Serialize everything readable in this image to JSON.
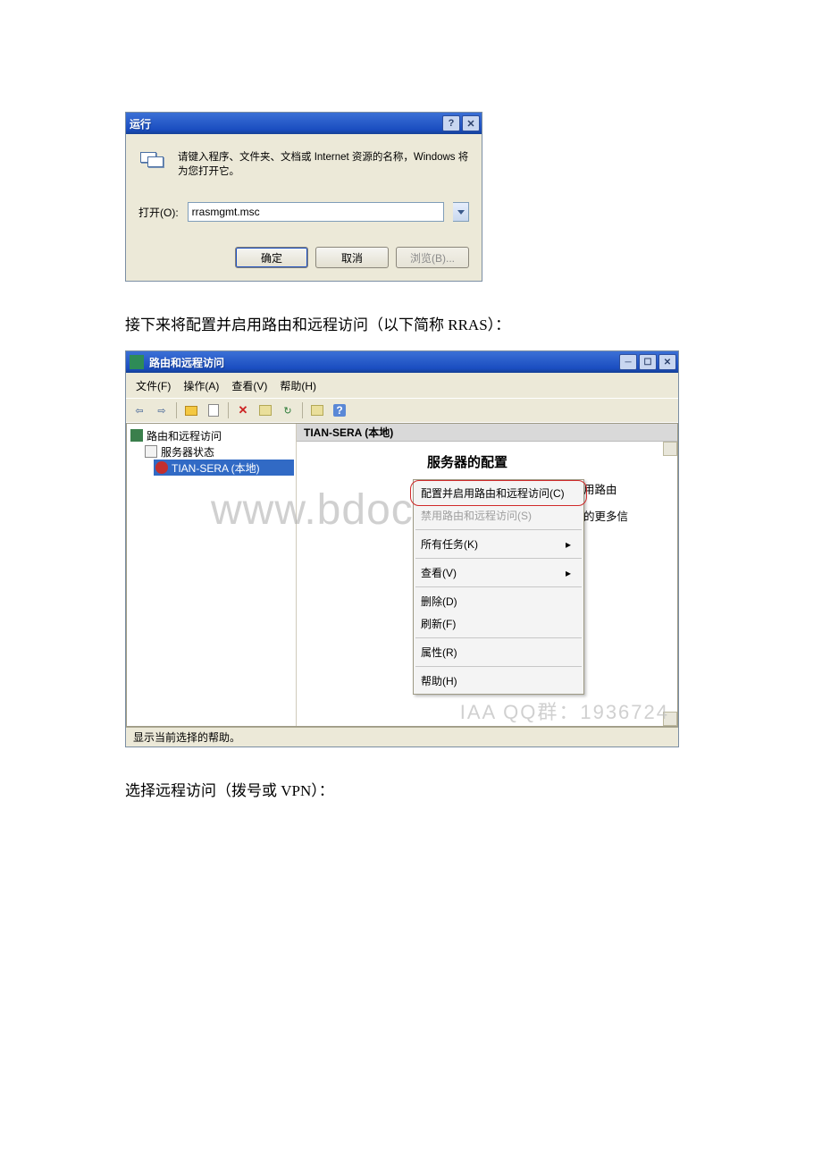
{
  "run_dialog": {
    "title": "运行",
    "description": "请键入程序、文件夹、文档或 Internet 资源的名称，Windows 将为您打开它。",
    "open_label": "打开(O):",
    "open_value": "rrasmgmt.msc",
    "ok_button": "确定",
    "cancel_button": "取消",
    "browse_button": "浏览(B)..."
  },
  "caption1": "接下来将配置并启用路由和远程访问（以下简称 RRAS）：",
  "caption2": "选择远程访问（拨号或 VPN）：",
  "mmc": {
    "title": "路由和远程访问",
    "menus": {
      "file": "文件(F)",
      "action": "操作(A)",
      "view": "查看(V)",
      "help": "帮助(H)"
    },
    "tree": {
      "root": "路由和远程访问",
      "status": "服务器状态",
      "server": "TIAN-SERA (本地)"
    },
    "content_header": "TIAN-SERA (本地)",
    "content_heading": "服务器的配置",
    "content_line1": "，在“操作”菜单上单击“配置并启用路由",
    "content_line2": "访问，部署方案，以及疑难解答的更多信息，",
    "statusbar": "显示当前选择的帮助。",
    "context_menu": {
      "configure": "配置并启用路由和远程访问(C)",
      "disable": "禁用路由和远程访问(S)",
      "all_tasks": "所有任务(K)",
      "view": "查看(V)",
      "delete": "删除(D)",
      "refresh": "刷新(F)",
      "properties": "属性(R)",
      "help": "帮助(H)"
    }
  },
  "watermarks": {
    "main": "www.bdocx.com",
    "qq": "IAA   QQ群：1936724"
  }
}
